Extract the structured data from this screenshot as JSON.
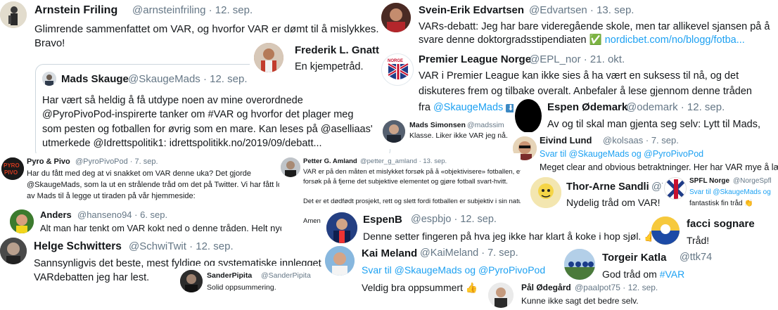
{
  "tweets": {
    "arnstein": {
      "name": "Arnstein Friling",
      "handle": "@arnsteinfriling · 12. sep.",
      "text1": "Glimrende sammenfattet om VAR, og hvorfor VAR er dømt til å mislykkes.",
      "text2": "Bravo!"
    },
    "frederik": {
      "name": "Frederik L. Gnatt",
      "text": "En kjempetråd."
    },
    "mads_quote": {
      "name": "Mads Skauge",
      "handle": "@SkaugeMads · 12. sep.",
      "lines": [
        "Har vært så heldig å få utdype noen av mine overordnede",
        "@PyroPivoPod-inspirerte tanker om #VAR og hvorfor det plager meg",
        "som pesten og fotballen for øvrig som en mare. Kan leses på @aselliaas'",
        "utmerkede @Idrettspolitik1: idrettspolitikk.no/2019/09/debatt..."
      ]
    },
    "sveinerik": {
      "name": "Svein-Erik Edvartsen",
      "handle": "@Edvartsen · 13. sep.",
      "text1": "VARs-debatt: Jeg har bare videregående skole, men tar allikevel sjansen på å",
      "text2a": "svare denne doktorgradsstipendiaten",
      "check": "✅",
      "text2b": "nordicbet.com/no/blogg/fotba..."
    },
    "epl": {
      "name": "Premier League Norge",
      "handle": "@EPL_nor · 21. okt.",
      "lines": [
        "VAR i Premier League kan ikke sies å ha vært en suksess til nå, og det",
        "diskuteres frem og tilbake overalt. Anbefaler å lese gjennom denne tråden"
      ],
      "text3a": "fra",
      "text3b": "@SkaugeMads",
      "arrow": "⬇"
    },
    "espen_o": {
      "name": "Espen Ødemark",
      "handle": "@odemark · 12. sep.",
      "text": "Av og til skal man gjenta seg selv: Lytt til Mads,"
    },
    "mads_simonsen": {
      "name": "Mads Simonsen",
      "handle": "@madssim",
      "text": "Klasse. Liker ikke VAR jeg nå."
    },
    "eivind": {
      "name": "Eivind Lund",
      "handle": "@kolsaas · 7. sep.",
      "reply": "Svar til @SkaugeMads og @PyroPivoPod",
      "text": "Meget clear and obvious betraktninger. Her har VAR mye å lære 👍"
    },
    "pyro": {
      "name": "Pyro & Pivo",
      "handle": "@PyroPivoPod · 7. sep.",
      "lines": [
        "Har du fått med deg at vi snakket om VAR denne uka? Det gjorde",
        "@SkaugeMads, som la ut en strålende tråd om det på Twitter. Vi har fått lov",
        "av Mads til å legge ut tiraden på vår hjemmeside:"
      ],
      "logo_text": "PYRO PIVO"
    },
    "petter": {
      "name": "Petter G. Amland",
      "handle": "@petter_g_amland · 13. sep.",
      "lines": [
        "VAR er på den måten et mislykket forsøk på å «objektivisere» fotballen, et",
        "forsøk på å fjerne det subjektive elementet og gjøre fotball svart-hvitt.",
        "",
        "Det er et dødfødt prosjekt, rett og slett fordi fotballen er subjektiv i sin natur.",
        "",
        "Amen 🙏"
      ]
    },
    "thor": {
      "name": "Thor-Arne Sandli",
      "handle": "@T",
      "text": "Nydelig tråd om VAR!"
    },
    "spfl": {
      "name": "SPFL Norge",
      "handle": "@NorgeSpfl",
      "reply": "Svar til @SkaugeMads og",
      "text": "fantastisk fin tråd 👏"
    },
    "anders": {
      "name": "Anders",
      "handle": "@hanseno94 · 6. sep.",
      "text": "Alt man har tenkt om VAR kokt ned o denne tråden. Helt nydelig"
    },
    "espenb": {
      "name": "EspenB",
      "handle": "@espbjo · 12. sep.",
      "text": "Denne setter fingeren på hva jeg ikke har klart å koke i hop sjøl.",
      "emoji": "👍"
    },
    "facci": {
      "name": "facci sognare",
      "text": "Tråd!"
    },
    "helge": {
      "name": "Helge Schwitters",
      "handle": "@SchwiTwit · 12. sep.",
      "text1": "Sannsynligvis det beste, mest fyldige og systematiske innlegget i",
      "text2": "VARdebatten jeg har lest."
    },
    "kai": {
      "name": "Kai Meland",
      "handle": "@KaiMeland · 7. sep.",
      "reply": "Svar til @SkaugeMads og @PyroPivoPod",
      "text": "Veldig bra oppsummert",
      "emoji": "👍"
    },
    "torgeir": {
      "name": "Torgeir Katla",
      "handle": "@ttk74",
      "text_a": "God tråd om",
      "text_b": "#VAR"
    },
    "sander": {
      "name": "SanderPipita",
      "handle": "@SanderPipita",
      "text": "Solid oppsummering."
    },
    "pal": {
      "name": "Pål Ødegård",
      "handle": "@paalpot75 · 12. sep.",
      "text": "Kunne ikke sagt det bedre selv."
    }
  },
  "colors": {
    "link": "#1da1f2",
    "muted": "#657786",
    "text": "#14171a",
    "border": "#ccd6dd"
  }
}
